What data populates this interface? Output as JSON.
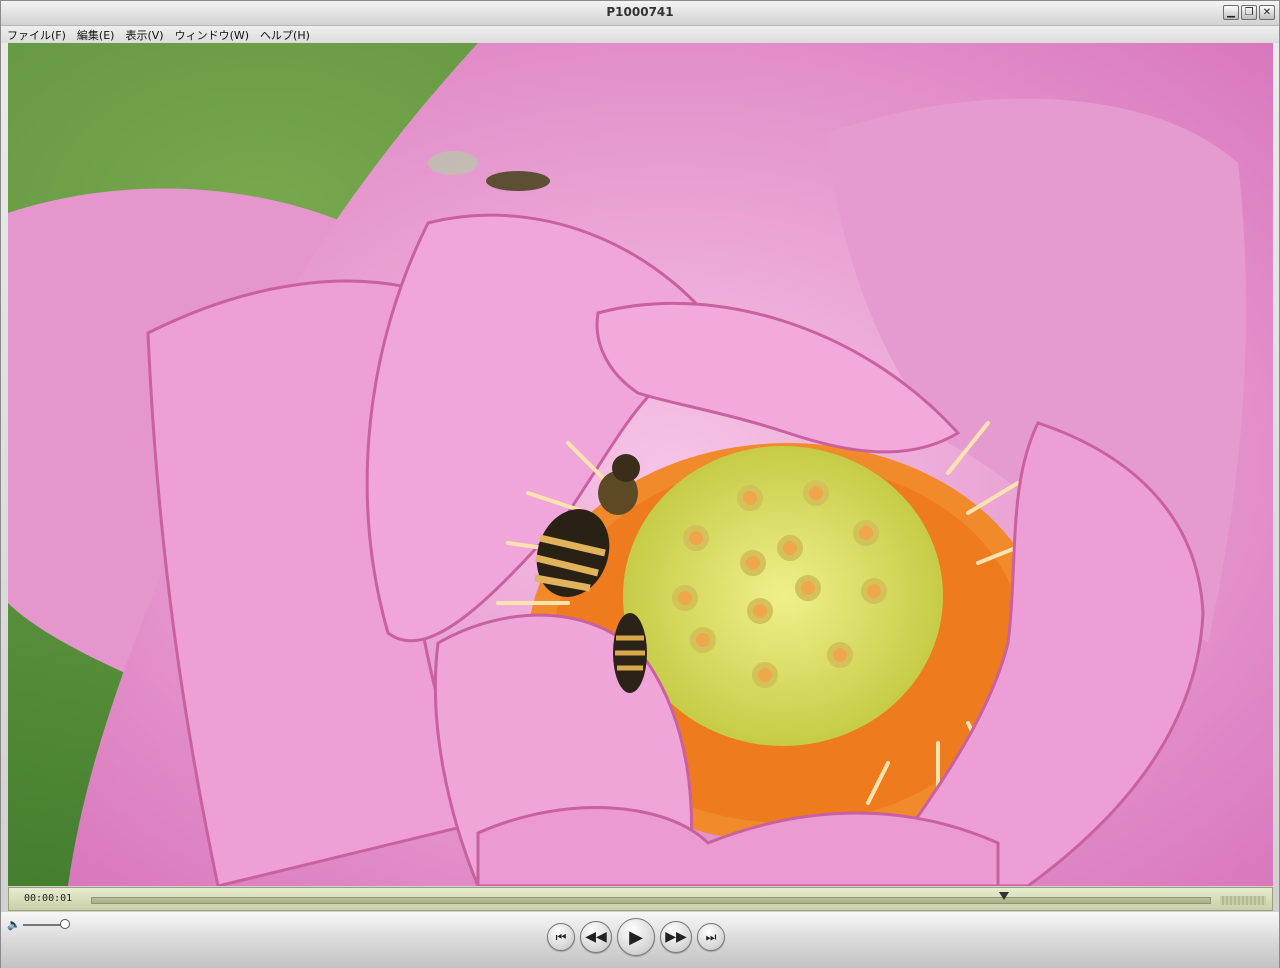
{
  "window": {
    "title": "P1000741"
  },
  "window_buttons": [
    {
      "name": "minimize-button",
      "glyph": "▁"
    },
    {
      "name": "maximize-button",
      "glyph": "❐"
    },
    {
      "name": "close-button",
      "glyph": "✕"
    }
  ],
  "menu": [
    "ファイル(F)",
    "編集(E)",
    "表示(V)",
    "ウィンドウ(W)",
    "ヘルプ(H)"
  ],
  "player": {
    "timecode": "00:00:01",
    "playhead_fraction": 0.815,
    "volume_fraction": 1.0
  },
  "transport": {
    "go_to_start": "⏮",
    "rewind": "◀◀",
    "play": "▶",
    "fast_forward": "▶▶",
    "go_to_end": "⏭"
  },
  "icons": {
    "volume": "speaker-icon"
  },
  "colors": {
    "timeline_bg": "#d8ddb8",
    "petal": "#e79ad0",
    "background_green": "#4f8a36"
  }
}
